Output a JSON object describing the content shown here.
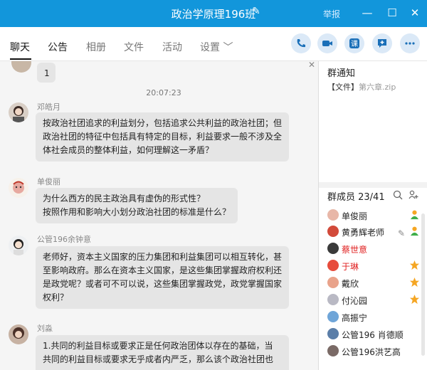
{
  "window": {
    "title": "政治学原理196班",
    "report": "举报",
    "controls": [
      "—",
      "☐",
      "✕"
    ]
  },
  "tabs": [
    "聊天",
    "公告",
    "相册",
    "文件",
    "活动",
    "设置 ﹀"
  ],
  "chat": {
    "prev_message": "1",
    "timestamp": "20:07:23",
    "messages": [
      {
        "user": "邓皓月",
        "lines": [
          "按政治社团追求的利益划分，包括追求公共利益的政治社团；但",
          "政治社团的特征中包括具有特定的目标，利益要求一般不涉及全",
          "体社会成员的整体利益，如何理解这一矛盾？"
        ]
      },
      {
        "user": "单俊丽",
        "lines": [
          "为什么西方的民主政治具有虚伪的形式性？",
          "按照作用和影响大小划分政治社团的标准是什么？"
        ]
      },
      {
        "user": "公管196余钟意",
        "lines": [
          "老师好，资本主义国家的压力集团和利益集团可以相互转化，甚",
          "至影响政府。那么在资本主义国家，是这些集团掌握政府权利还",
          "是政党呢？或者可不可以说，这些集团掌握政党，政党掌握国家",
          "权利？"
        ]
      },
      {
        "user": "刘淼",
        "lines": [
          "1.共同的利益目标或要求正是任何政治团体以存在的基础，当",
          "共同的利益目标或要求无乎成者内严乏，那么该个政治社团也"
        ]
      }
    ]
  },
  "sidebar": {
    "notice_title": "群通知",
    "notice_file_prefix": "【文件】",
    "notice_file_name": "第六章.zip",
    "members_title": "群成员 23/41",
    "members": [
      {
        "name": "单俊丽",
        "style": "normal",
        "badge": "person"
      },
      {
        "name": "黄勇辉老师",
        "style": "normal",
        "badge": "person-edit"
      },
      {
        "name": "蔡世意",
        "style": "red",
        "badge": ""
      },
      {
        "name": "于琳",
        "style": "red",
        "badge": "star"
      },
      {
        "name": "戴欣",
        "style": "normal",
        "badge": "star"
      },
      {
        "name": "付沁园",
        "style": "normal",
        "badge": "star"
      },
      {
        "name": "高振宁",
        "style": "normal",
        "badge": ""
      },
      {
        "name": "公管196 肖德顺",
        "style": "normal",
        "badge": ""
      },
      {
        "name": "公管196洪艺高",
        "style": "normal",
        "badge": ""
      }
    ]
  },
  "colors": {
    "titlebar": "#1296db",
    "bubble": "#e5e5e5",
    "star": "#f5a623",
    "red_name": "#e02020"
  }
}
